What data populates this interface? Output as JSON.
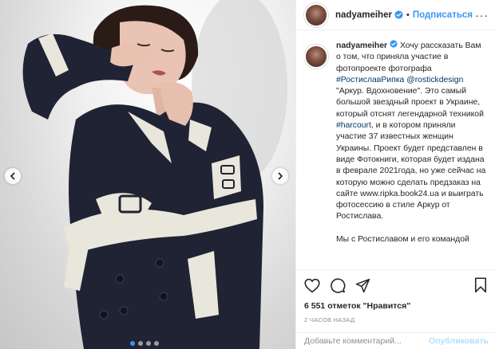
{
  "post": {
    "username": "nadyameiher",
    "follow_label": "Подписаться",
    "separator": "•",
    "more_label": "···"
  },
  "caption": {
    "username": "nadyameiher",
    "segments": [
      {
        "type": "text",
        "value": " Хочу рассказать Вам о том, что приняла участие в фотопроекте фотографа "
      },
      {
        "type": "link",
        "value": "#РостиславРипка"
      },
      {
        "type": "text",
        "value": " "
      },
      {
        "type": "link",
        "value": "@rostickdesign"
      },
      {
        "type": "text",
        "value": "\n\"Аркур. Вдохновение\". Это самый большой звездный проект в Украине, который отснят легендарной техникой "
      },
      {
        "type": "link",
        "value": "#harcourt"
      },
      {
        "type": "text",
        "value": ", и в котором приняли участие 37 известных женщин Украины. Проект будет представлен в виде Фотокниги, которая будет издана в феврале 2021года, но уже сейчас на которую можно сделать предзаказ на сайте www.ripka.book24.ua и выиграть фотосессию в стиле Аркур от Ростислава.\n\nМы с Ростиславом и его командой"
      }
    ]
  },
  "stats": {
    "likes": "6 551 отметок \"Нравится\"",
    "time": "2 часов назад"
  },
  "comment": {
    "placeholder": "Добавьте комментарий...",
    "publish_label": "Опубликовать"
  },
  "carousel": {
    "slide_count": 4,
    "active_index": 0
  },
  "colors": {
    "accent": "#3897f0",
    "link": "#00376b",
    "coat": "#1f2333",
    "trim": "#e9e6dc",
    "divider": "#efefef"
  },
  "icons": [
    "verified-badge-icon",
    "heart-icon",
    "comment-icon",
    "share-icon",
    "bookmark-icon",
    "chevron-left-icon",
    "chevron-right-icon"
  ]
}
